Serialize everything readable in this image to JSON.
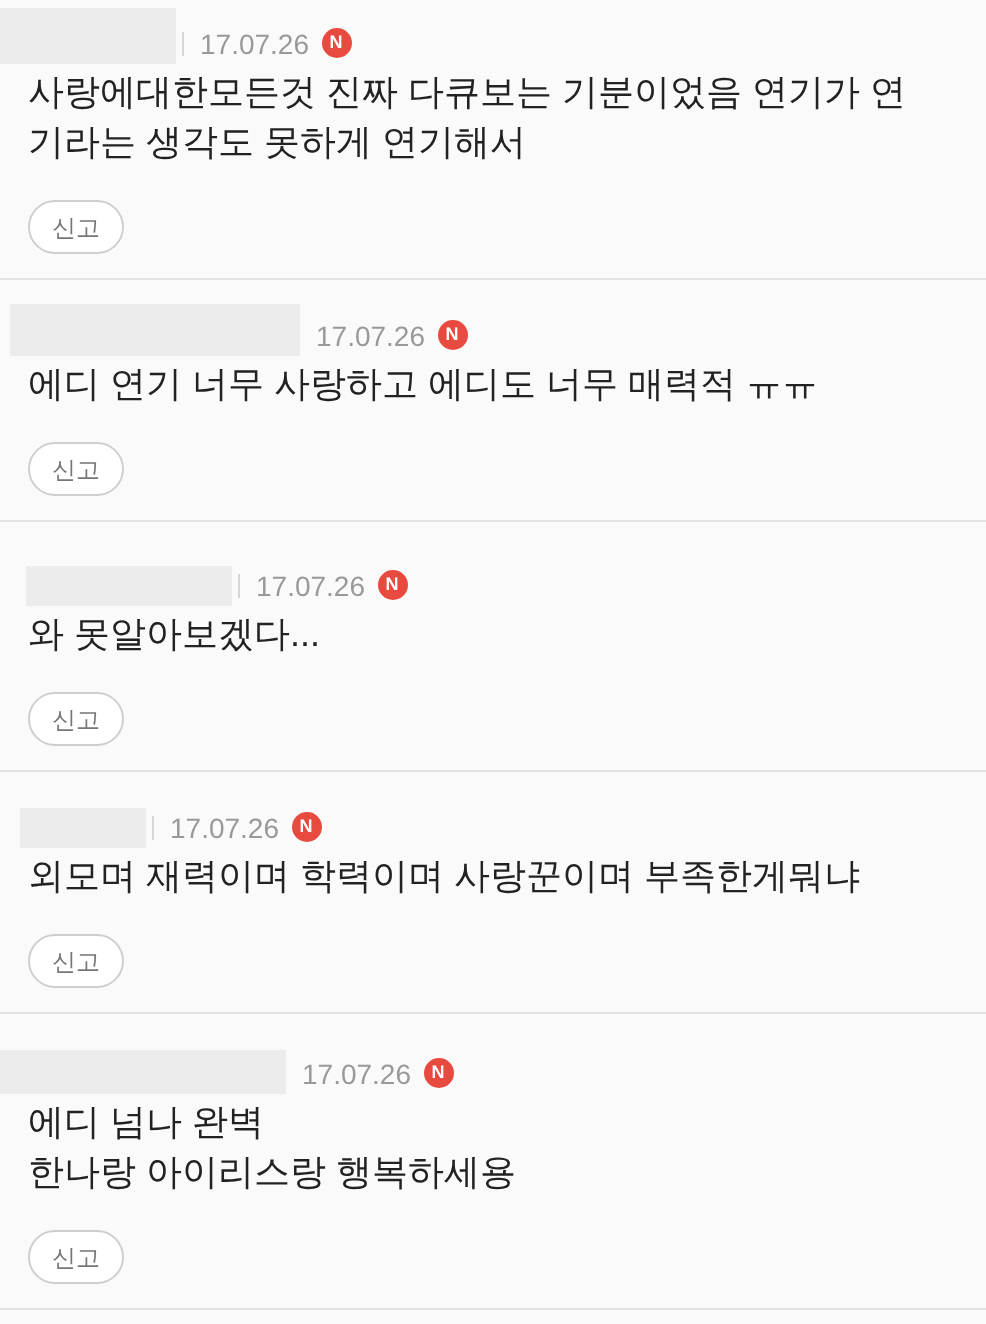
{
  "comments": [
    {
      "date": "17.07.26",
      "badge": "N",
      "lines": [
        "사랑에대한모든것 진짜 다큐보는 기분이었음 연기가 연",
        "기라는 생각도 못하게 연기해서"
      ],
      "report": "신고"
    },
    {
      "date": "17.07.26",
      "badge": "N",
      "lines": [
        "에디 연기 너무 사랑하고 에디도 너무 매력적 ㅠㅠ"
      ],
      "report": "신고"
    },
    {
      "date": "17.07.26",
      "badge": "N",
      "lines": [
        "와 못알아보겠다..."
      ],
      "report": "신고"
    },
    {
      "date": "17.07.26",
      "badge": "N",
      "lines": [
        "외모며 재력이며 학력이며 사랑꾼이며 부족한게뭐냐"
      ],
      "report": "신고"
    },
    {
      "date": "17.07.26",
      "badge": "N",
      "lines": [
        "에디 넘나 완벽",
        "한나랑 아이리스랑 행복하세용"
      ],
      "report": "신고"
    }
  ]
}
